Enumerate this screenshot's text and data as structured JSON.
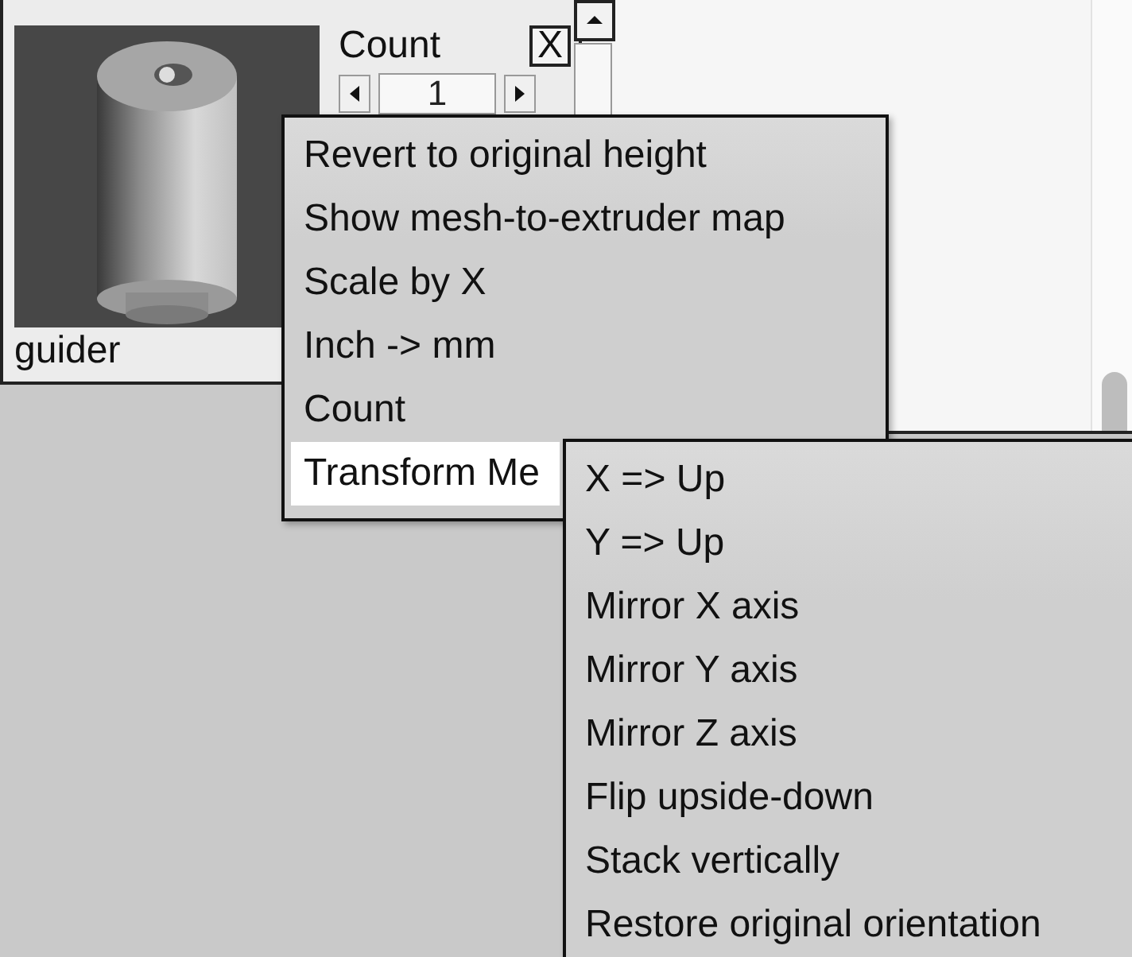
{
  "panel": {
    "name": "guider",
    "count_label": "Count",
    "close_button": "X",
    "count_value": "1"
  },
  "context_menu": {
    "items": [
      {
        "label": "Revert to original height",
        "selected": false
      },
      {
        "label": "Show mesh-to-extruder map",
        "selected": false
      },
      {
        "label": "Scale by X",
        "selected": false
      },
      {
        "label": "Inch -> mm",
        "selected": false
      },
      {
        "label": "Count",
        "selected": false
      },
      {
        "label": "Transform Me",
        "selected": true
      }
    ]
  },
  "submenu": {
    "items": [
      {
        "label": "X => Up",
        "selected": false
      },
      {
        "label": "Y => Up",
        "selected": false
      },
      {
        "label": "Mirror X axis",
        "selected": false
      },
      {
        "label": "Mirror Y axis",
        "selected": false
      },
      {
        "label": "Mirror Z axis",
        "selected": false
      },
      {
        "label": "Flip upside-down",
        "selected": false
      },
      {
        "label": "Stack vertically",
        "selected": false
      },
      {
        "label": "Restore original orientation",
        "selected": false
      }
    ]
  }
}
